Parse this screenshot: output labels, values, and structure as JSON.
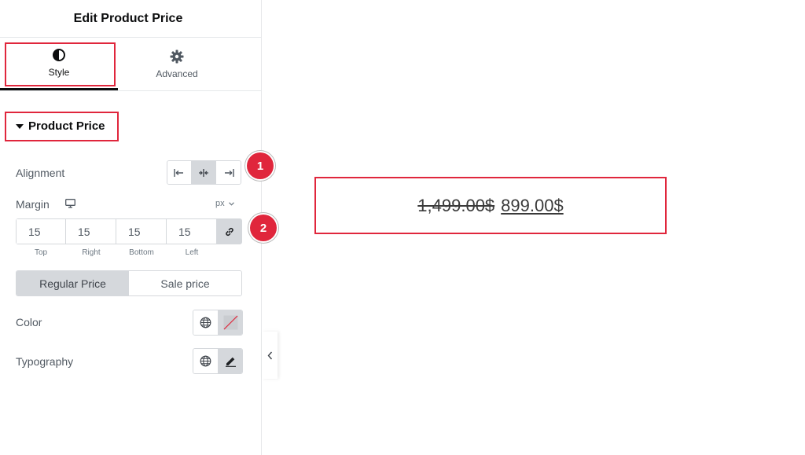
{
  "panel": {
    "title": "Edit Product Price",
    "tabs": [
      {
        "label": "Style",
        "icon": "contrast-icon",
        "active": true
      },
      {
        "label": "Advanced",
        "icon": "gear-icon",
        "active": false
      }
    ]
  },
  "section": {
    "title": "Product Price",
    "alignment": {
      "label": "Alignment",
      "options": [
        "align-left",
        "align-center",
        "align-right"
      ],
      "selected": "align-center"
    },
    "margin": {
      "label": "Margin",
      "device_icon": "desktop-icon",
      "unit": "px",
      "values": {
        "top": "15",
        "right": "15",
        "bottom": "15",
        "left": "15"
      },
      "labels": {
        "top": "Top",
        "right": "Right",
        "bottom": "Bottom",
        "left": "Left"
      }
    },
    "price_tabs": [
      {
        "label": "Regular Price",
        "active": true
      },
      {
        "label": "Sale price",
        "active": false
      }
    ],
    "color_label": "Color",
    "typography_label": "Typography"
  },
  "badges": [
    "1",
    "2"
  ],
  "preview": {
    "regular_price": "1,499.00$",
    "sale_price": "899.00$"
  },
  "colors": {
    "highlight": "#e0263c",
    "active_control": "#d5d8dc",
    "text": "#515962"
  }
}
